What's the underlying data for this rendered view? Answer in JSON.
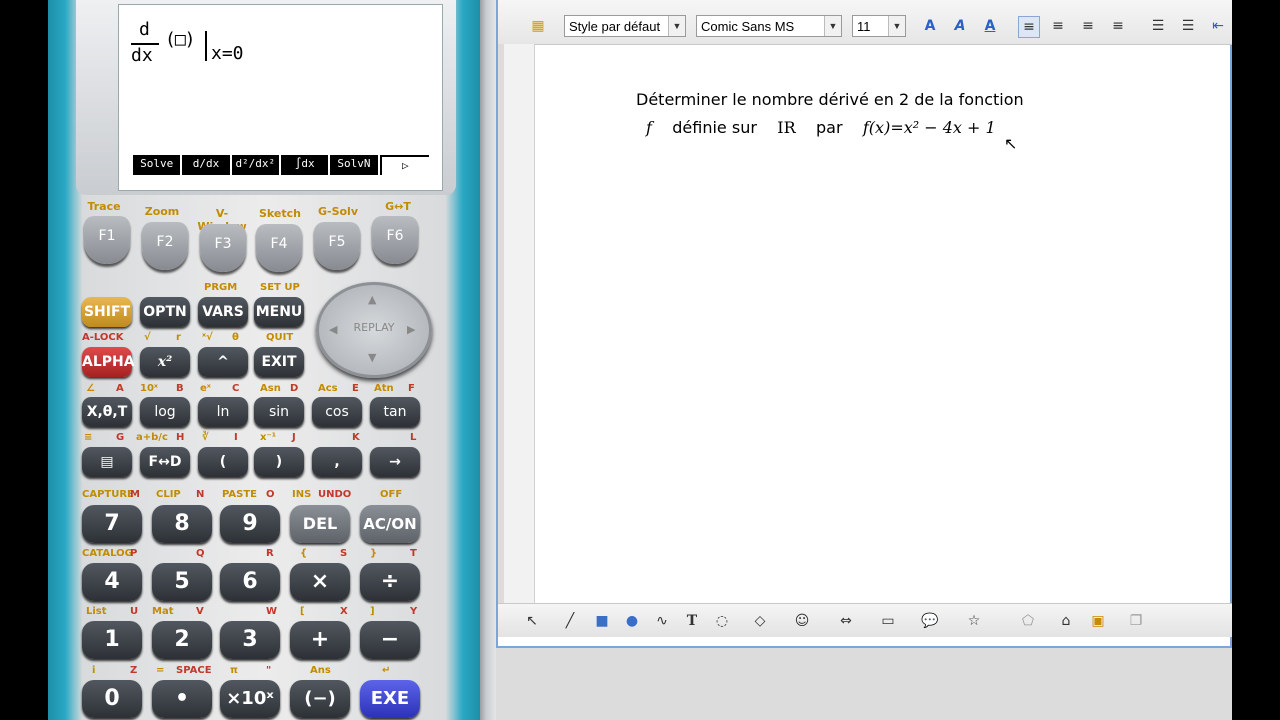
{
  "calculator": {
    "screen": {
      "d_num": "d",
      "d_den": "dx",
      "arg": "(□)",
      "eval": "x=0",
      "fkeys": [
        "Solve",
        "d/dx",
        "d²/dx²",
        "∫dx",
        "SolvN",
        "▷"
      ]
    },
    "function_keys": [
      {
        "label": "Trace",
        "key": "F1"
      },
      {
        "label": "Zoom",
        "key": "F2"
      },
      {
        "label": "V-Window",
        "key": "F3"
      },
      {
        "label": "Sketch",
        "key": "F4"
      },
      {
        "label": "G-Solv",
        "key": "F5"
      },
      {
        "label": "G↔T",
        "key": "F6"
      }
    ],
    "row1": {
      "shift": "SHIFT",
      "optn": "OPTN",
      "vars": "VARS",
      "menu": "MENU",
      "prgm": "PRGM",
      "setup": "SET UP"
    },
    "row2": {
      "alpha": "ALPHA",
      "square": "x²",
      "caret": "^",
      "exit": "EXIT",
      "alock": "A-LOCK",
      "sqrt": "√",
      "r": "r",
      "xroot": "ˣ√",
      "theta": "θ",
      "quit": "QUIT"
    },
    "replay": "REPLAY",
    "row3_labels": [
      "∠",
      "A",
      "10ˣ",
      "B",
      "eˣ",
      "C",
      "Asn",
      "D",
      "Acs",
      "E",
      "Atn",
      "F"
    ],
    "row3": [
      "X,θ,T",
      "log",
      "ln",
      "sin",
      "cos",
      "tan"
    ],
    "row4_labels": [
      "≡",
      "G",
      "a+b/c",
      "H",
      "∛",
      "I",
      "x⁻¹",
      "J",
      "K",
      "L"
    ],
    "row4": [
      "▤",
      "F↔D",
      "(",
      ")",
      ",",
      "→"
    ],
    "row5_labels": [
      "CAPTURE",
      "M",
      "CLIP",
      "N",
      "PASTE",
      "O",
      "INS",
      "UNDO",
      "OFF"
    ],
    "row5": [
      "7",
      "8",
      "9",
      "DEL",
      "AC/ON"
    ],
    "row6_labels": [
      "CATALOG",
      "P",
      "Q",
      "R",
      "{",
      "S",
      "}",
      "T"
    ],
    "row6": [
      "4",
      "5",
      "6",
      "×",
      "÷"
    ],
    "row7_labels": [
      "List",
      "U",
      "Mat",
      "V",
      "W",
      "[",
      "X",
      "]",
      "Y"
    ],
    "row7": [
      "1",
      "2",
      "3",
      "+",
      "−"
    ],
    "row8_labels": [
      "i",
      "Z",
      "=",
      "SPACE",
      "π",
      "\"",
      "Ans",
      "↵"
    ],
    "row8": [
      "0",
      "•",
      "×10ˣ",
      "(−)",
      "EXE"
    ]
  },
  "editor": {
    "style": "Style par défaut",
    "font": "Comic Sans MS",
    "size": "11",
    "line1": "Déterminer le nombre dérivé en 2 de la fonction",
    "line2_f": "f",
    "line2_text": "définie sur",
    "line2_R": "IR",
    "line2_par": "par",
    "line2_formula_lhs": "f(x)",
    "line2_formula_rhs": "=x² − 4x + 1"
  }
}
